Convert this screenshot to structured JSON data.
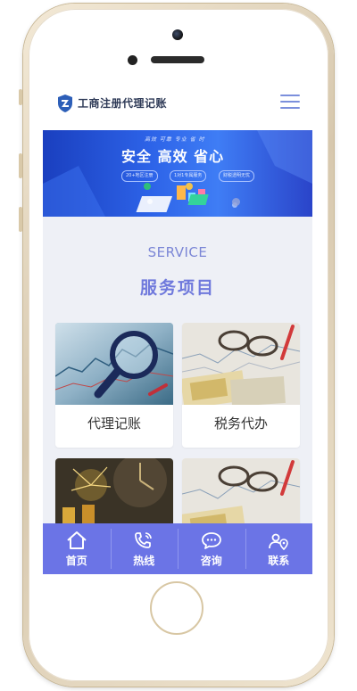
{
  "header": {
    "logo_text": "工商注册代理记账"
  },
  "banner": {
    "subtitle": "高效 可靠 专业 省 时",
    "title": "安全 高效 省心",
    "tags": [
      "20+地区注册",
      "1对1专属服务",
      "财税透明无忧"
    ]
  },
  "services": {
    "heading_en": "SERVICE",
    "heading_cn": "服务项目",
    "items": [
      {
        "label": "代理记账"
      },
      {
        "label": "税务代办"
      },
      {
        "label": ""
      },
      {
        "label": ""
      }
    ]
  },
  "bottom_nav": {
    "items": [
      {
        "label": "首页",
        "icon": "home-icon"
      },
      {
        "label": "热线",
        "icon": "phone-icon"
      },
      {
        "label": "咨询",
        "icon": "chat-icon"
      },
      {
        "label": "联系",
        "icon": "location-user-icon"
      }
    ]
  },
  "colors": {
    "accent": "#6b74e6",
    "heading": "#6f79dc",
    "banner_blue": "#2d63e8"
  }
}
